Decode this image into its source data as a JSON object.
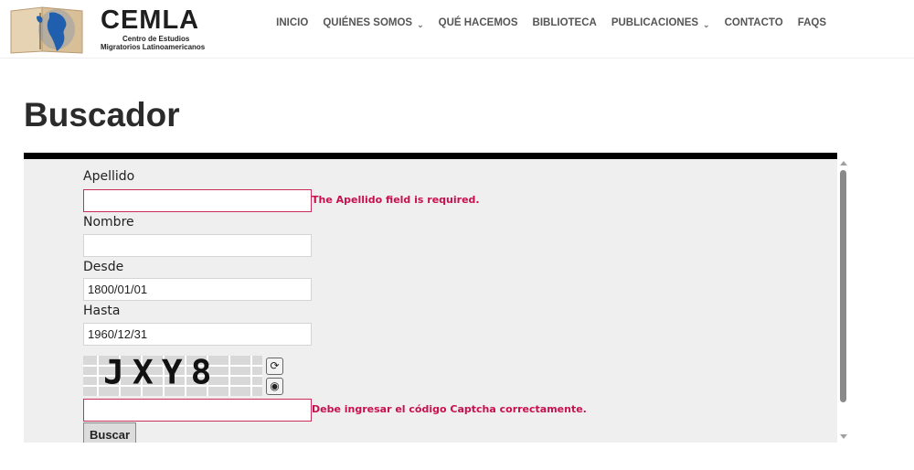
{
  "header": {
    "logo_title": "CEMLA",
    "logo_subtitle_1": "Centro de Estudios",
    "logo_subtitle_2": "Migratorios Latinoamericanos",
    "nav": [
      {
        "label": "INICIO",
        "dropdown": false
      },
      {
        "label": "QUIÉNES SOMOS",
        "dropdown": true
      },
      {
        "label": "QUÉ HACEMOS",
        "dropdown": false
      },
      {
        "label": "BIBLIOTECA",
        "dropdown": false
      },
      {
        "label": "PUBLICACIONES",
        "dropdown": true
      },
      {
        "label": "CONTACTO",
        "dropdown": false
      },
      {
        "label": "FAQS",
        "dropdown": false
      }
    ]
  },
  "page": {
    "title": "Buscador"
  },
  "form": {
    "apellido": {
      "label": "Apellido",
      "value": "",
      "error": "The Apellido field is required."
    },
    "nombre": {
      "label": "Nombre",
      "value": ""
    },
    "desde": {
      "label": "Desde",
      "value": "1800/01/01"
    },
    "hasta": {
      "label": "Hasta",
      "value": "1960/12/31"
    },
    "captcha": {
      "text": "JXY8",
      "value": "",
      "error": "Debe ingresar el código Captcha correctamente.",
      "refresh_icon": "refresh-icon",
      "audio_icon": "audio-icon"
    },
    "submit_label": "Buscar"
  },
  "colors": {
    "error": "#c8104e",
    "frame_bg": "#efefef",
    "frame_top": "#000000"
  }
}
